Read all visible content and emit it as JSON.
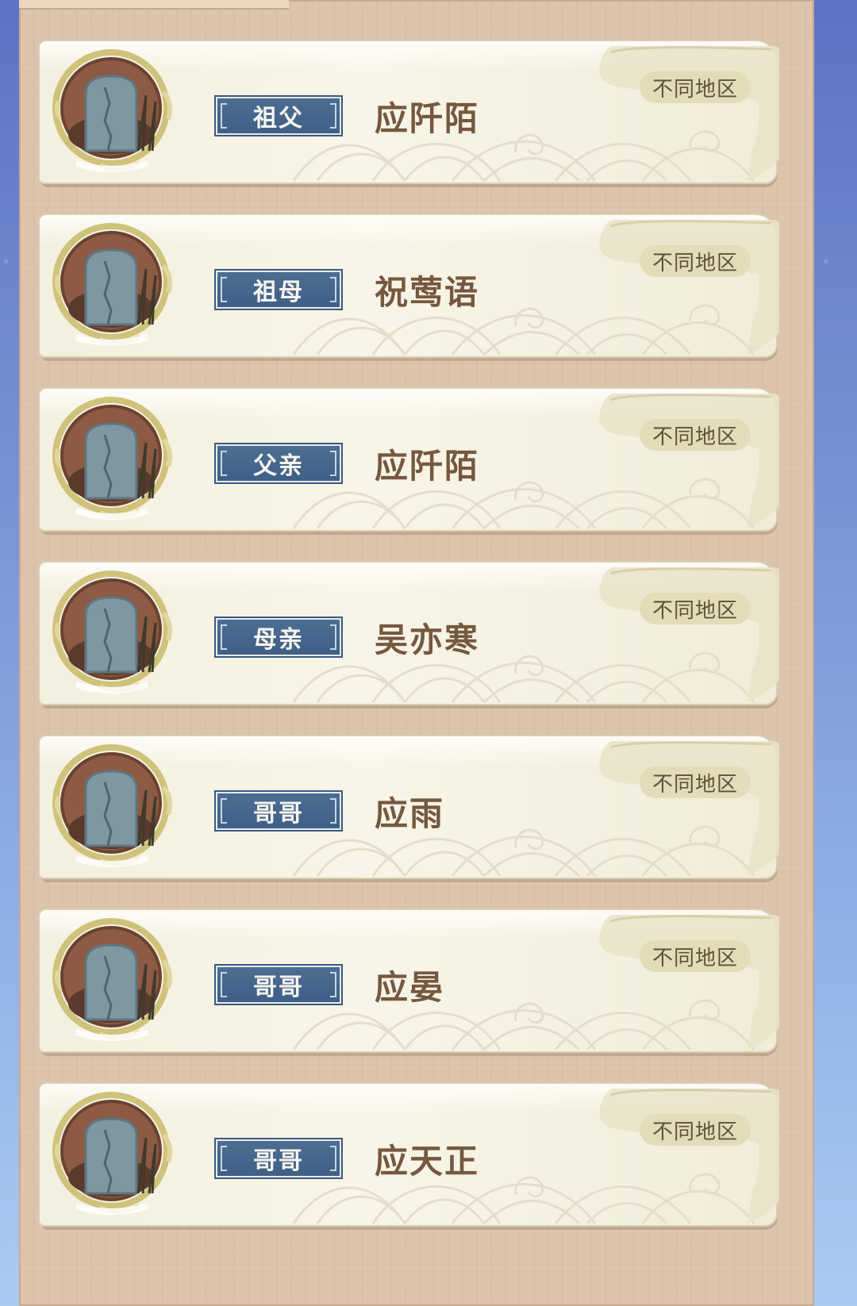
{
  "family_members": [
    {
      "relation": "祖父",
      "name": "应阡陌",
      "region": "不同地区",
      "avatar_icon": "tombstone-icon"
    },
    {
      "relation": "祖母",
      "name": "祝莺语",
      "region": "不同地区",
      "avatar_icon": "tombstone-icon"
    },
    {
      "relation": "父亲",
      "name": "应阡陌",
      "region": "不同地区",
      "avatar_icon": "tombstone-icon"
    },
    {
      "relation": "母亲",
      "name": "吴亦寒",
      "region": "不同地区",
      "avatar_icon": "tombstone-icon"
    },
    {
      "relation": "哥哥",
      "name": "应雨",
      "region": "不同地区",
      "avatar_icon": "tombstone-icon"
    },
    {
      "relation": "哥哥",
      "name": "应晏",
      "region": "不同地区",
      "avatar_icon": "tombstone-icon"
    },
    {
      "relation": "哥哥",
      "name": "应天正",
      "region": "不同地区",
      "avatar_icon": "tombstone-icon"
    }
  ],
  "colors": {
    "relation_badge": "#426188",
    "name_text": "#75583f",
    "card_bg": "#f4f0df",
    "region_badge": "#e3dcb8"
  }
}
